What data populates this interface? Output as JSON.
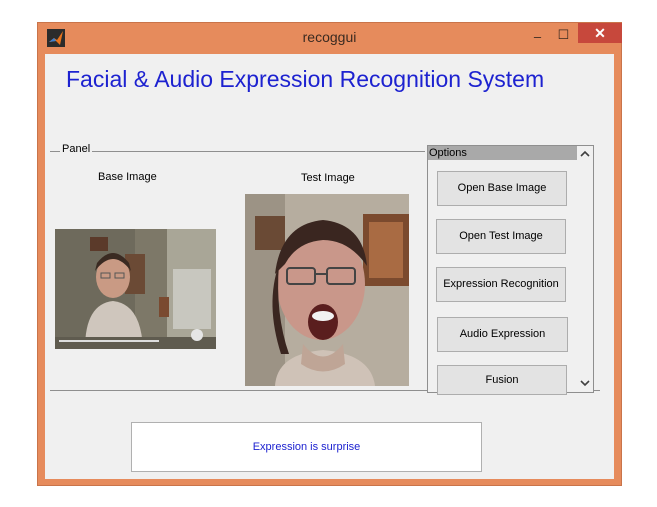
{
  "window": {
    "title": "recoggui",
    "minimize_glyph": "–",
    "maximize_glyph": "☐",
    "close_glyph": "✕",
    "frame_color": "#e68b5c",
    "close_color": "#c7483c"
  },
  "app": {
    "heading": "Facial & Audio Expression Recognition System",
    "heading_color": "#1d22d0"
  },
  "panel": {
    "label": "Panel",
    "base_image_label": "Base Image",
    "test_image_label": "Test Image"
  },
  "options": {
    "header": "Options",
    "buttons": [
      {
        "label": "Open Base Image"
      },
      {
        "label": "Open Test Image"
      },
      {
        "label": "Expression Recognition"
      },
      {
        "label": "Audio Expression"
      },
      {
        "label": "Fusion"
      }
    ]
  },
  "result": {
    "text": "Expression is surprise"
  }
}
